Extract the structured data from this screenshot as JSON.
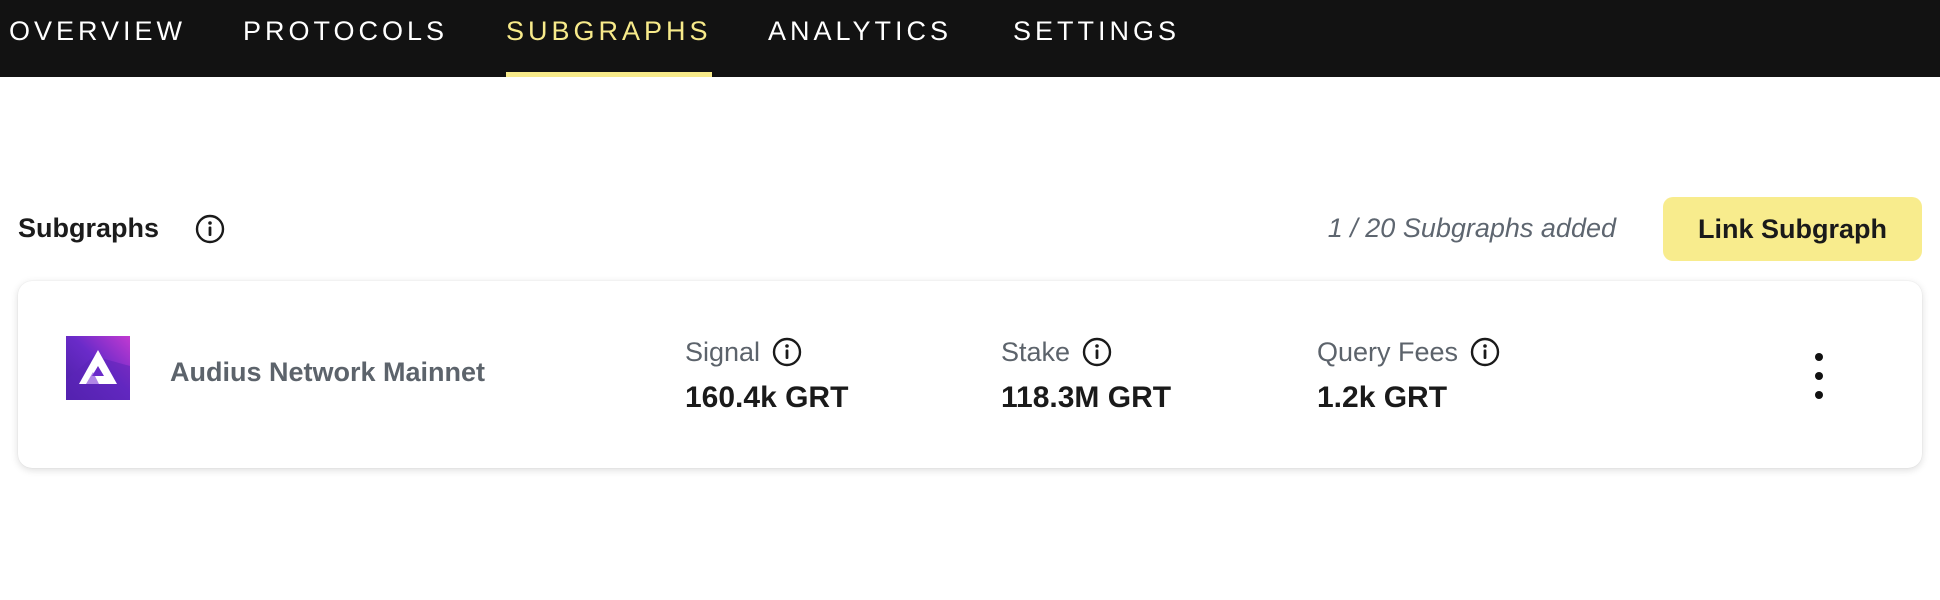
{
  "nav": {
    "tabs": [
      {
        "label": "OVERVIEW",
        "active": false
      },
      {
        "label": "PROTOCOLS",
        "active": false
      },
      {
        "label": "SUBGRAPHS",
        "active": true
      },
      {
        "label": "ANALYTICS",
        "active": false
      },
      {
        "label": "SETTINGS",
        "active": false
      }
    ]
  },
  "section": {
    "title": "Subgraphs",
    "count_text": "1 / 20 Subgraphs added",
    "link_button_label": "Link Subgraph"
  },
  "subgraphs": [
    {
      "name": "Audius Network Mainnet",
      "metrics": [
        {
          "label": "Signal",
          "value": "160.4k GRT"
        },
        {
          "label": "Stake",
          "value": "118.3M GRT"
        },
        {
          "label": "Query Fees",
          "value": "1.2k GRT"
        }
      ]
    }
  ],
  "colors": {
    "nav_background": "#121212",
    "active_tab": "#f7ea8a",
    "button_background": "#f8ec8d",
    "muted_text": "#5c636b"
  },
  "icons": {
    "info": "info-circle-icon",
    "more": "more-vertical-icon",
    "logo": "audius-logo-icon"
  }
}
